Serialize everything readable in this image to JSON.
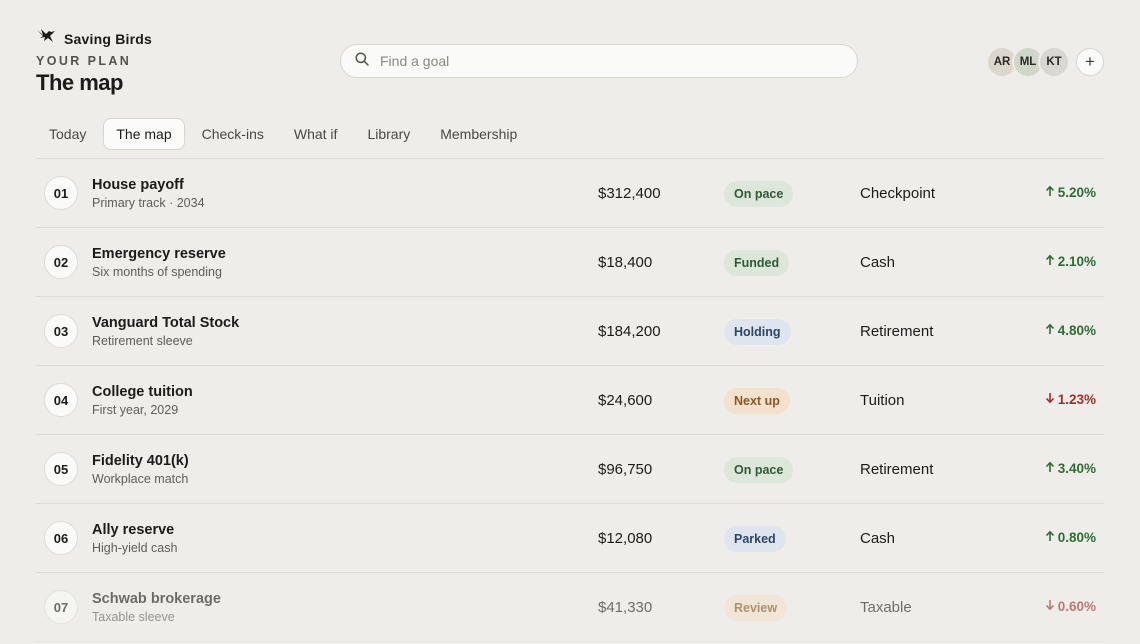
{
  "app": {
    "name": "Saving Birds"
  },
  "header": {
    "eyebrow": "YOUR PLAN",
    "title": "The map"
  },
  "search": {
    "placeholder": "Find a goal"
  },
  "users": [
    {
      "initials": "AR",
      "color": "#dcd6cc"
    },
    {
      "initials": "ML",
      "color": "#cfd8c8"
    },
    {
      "initials": "KT",
      "color": "#d9d7d2"
    }
  ],
  "add_label": "+",
  "tabs": [
    {
      "label": "Today",
      "active": false
    },
    {
      "label": "The map",
      "active": true
    },
    {
      "label": "Check-ins",
      "active": false
    },
    {
      "label": "What if",
      "active": false
    },
    {
      "label": "Library",
      "active": false
    },
    {
      "label": "Membership",
      "active": false
    }
  ],
  "status_styles": {
    "On pace": {
      "bg": "#dde6db",
      "fg": "#2f5a33"
    },
    "Funded": {
      "bg": "#dde6db",
      "fg": "#2f5a33"
    },
    "Holding": {
      "bg": "#dfe5ee",
      "fg": "#2e4564"
    },
    "Next up": {
      "bg": "#f1e1cd",
      "fg": "#8a5624"
    },
    "Parked": {
      "bg": "#dfe5ee",
      "fg": "#2e4564"
    },
    "Review": {
      "bg": "#f1e1cd",
      "fg": "#8a5624"
    }
  },
  "colors": {
    "up": "#2f6b35",
    "down": "#9c3128"
  },
  "goals": [
    {
      "num": "01",
      "name": "House payoff",
      "sub": "Primary track · 2034",
      "amount": "$312,400",
      "status": "On pace",
      "category": "Checkpoint",
      "change": "5.20%",
      "direction": "up"
    },
    {
      "num": "02",
      "name": "Emergency reserve",
      "sub": "Six months of spending",
      "amount": "$18,400",
      "status": "Funded",
      "category": "Cash",
      "change": "2.10%",
      "direction": "up"
    },
    {
      "num": "03",
      "name": "Vanguard Total Stock",
      "sub": "Retirement sleeve",
      "amount": "$184,200",
      "status": "Holding",
      "category": "Retirement",
      "change": "4.80%",
      "direction": "up"
    },
    {
      "num": "04",
      "name": "College tuition",
      "sub": "First year, 2029",
      "amount": "$24,600",
      "status": "Next up",
      "category": "Tuition",
      "change": "1.23%",
      "direction": "down"
    },
    {
      "num": "05",
      "name": "Fidelity 401(k)",
      "sub": "Workplace match",
      "amount": "$96,750",
      "status": "On pace",
      "category": "Retirement",
      "change": "3.40%",
      "direction": "up"
    },
    {
      "num": "06",
      "name": "Ally reserve",
      "sub": "High-yield cash",
      "amount": "$12,080",
      "status": "Parked",
      "category": "Cash",
      "change": "0.80%",
      "direction": "up"
    },
    {
      "num": "07",
      "name": "Schwab brokerage",
      "sub": "Taxable sleeve",
      "amount": "$41,330",
      "status": "Review",
      "category": "Taxable",
      "change": "0.60%",
      "direction": "down"
    }
  ]
}
